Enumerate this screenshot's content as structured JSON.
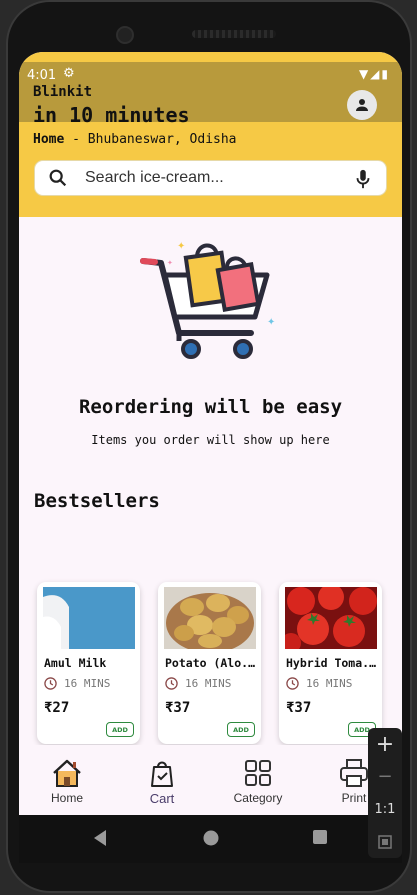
{
  "status_bar": {
    "time": "4:01"
  },
  "header": {
    "app_name": "Blinkit",
    "delivery_time": "in 10 minutes",
    "location_label": "Home",
    "location_separator": " - ",
    "location_value": "Bhubaneswar, Odisha"
  },
  "search": {
    "placeholder": "Search ice-cream..."
  },
  "empty_state": {
    "title": "Reordering will be easy",
    "subtitle": "Items you order will show up here"
  },
  "bestsellers": {
    "title": "Bestsellers",
    "products": [
      {
        "name": "Amul Milk",
        "time": "16 MINS",
        "price": "₹27",
        "add_label": "ADD"
      },
      {
        "name": "Potato (Alo...",
        "time": "16 MINS",
        "price": "₹37",
        "add_label": "ADD"
      },
      {
        "name": "Hybrid Toma...",
        "time": "16 MINS",
        "price": "₹37",
        "add_label": "ADD"
      }
    ]
  },
  "bottom_nav": {
    "items": [
      {
        "label": "Home",
        "icon": "home-icon"
      },
      {
        "label": "Cart",
        "icon": "cart-icon"
      },
      {
        "label": "Category",
        "icon": "category-icon"
      },
      {
        "label": "Print",
        "icon": "printer-icon"
      }
    ],
    "active": "Cart"
  },
  "zoom_controls": {
    "zoom_in": "+",
    "zoom_out": "−",
    "ratio": "1:1"
  },
  "colors": {
    "header": "#f6c945",
    "add_button": "#2e8a3e",
    "background": "#fcf5fb"
  }
}
